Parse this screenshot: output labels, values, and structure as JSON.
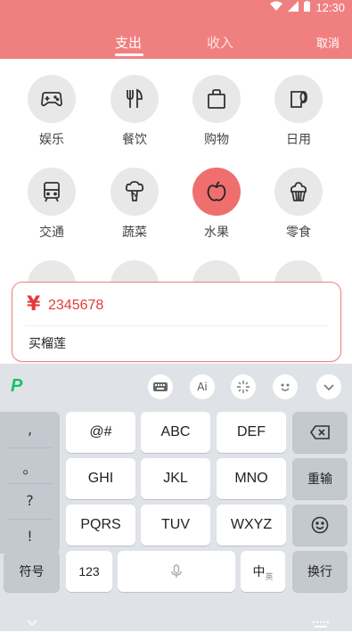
{
  "status_bar": {
    "time": "12:30"
  },
  "header": {
    "tabs": [
      {
        "label": "支出"
      },
      {
        "label": "收入"
      }
    ],
    "cancel_label": "取消",
    "accent_color": "#f08080"
  },
  "categories": [
    {
      "label": "娱乐",
      "icon": "gamepad-icon"
    },
    {
      "label": "餐饮",
      "icon": "fork-knife-icon"
    },
    {
      "label": "购物",
      "icon": "shopping-bag-icon"
    },
    {
      "label": "日用",
      "icon": "tissue-roll-icon"
    },
    {
      "label": "交通",
      "icon": "train-icon"
    },
    {
      "label": "蔬菜",
      "icon": "broccoli-icon"
    },
    {
      "label": "水果",
      "icon": "apple-icon",
      "selected": true
    },
    {
      "label": "零食",
      "icon": "cupcake-icon"
    }
  ],
  "amount_card": {
    "currency_symbol": "¥",
    "amount": "2345678",
    "note": "买榴莲"
  },
  "keyboard": {
    "toolbar_icons": [
      "keyboard-icon",
      "ai-icon",
      "sparkle-icon",
      "emoji-face-icon",
      "collapse-icon"
    ],
    "toolbar_ai_label": "Ai",
    "punctuation": [
      ",",
      "。",
      "?",
      "!"
    ],
    "rows": [
      [
        "@#",
        "ABC",
        "DEF"
      ],
      [
        "GHI",
        "JKL",
        "MNO"
      ],
      [
        "PQRS",
        "TUV",
        "WXYZ"
      ]
    ],
    "right_keys": {
      "backspace": "backspace-icon",
      "reenter": "重输",
      "emoji": "smiley-icon"
    },
    "bottom": {
      "symbols": "符号",
      "numbers": "123",
      "space_icon": "microphone-icon",
      "lang": "中",
      "lang_sub": "英",
      "newline": "换行"
    }
  }
}
